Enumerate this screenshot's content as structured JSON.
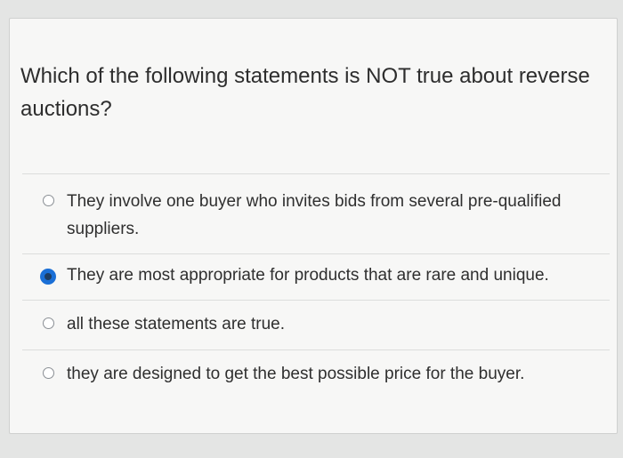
{
  "question": {
    "text": "Which of the following statements is NOT true about reverse auctions?"
  },
  "answers": [
    {
      "text": "They involve one buyer who invites bids from several pre-qualified suppliers.",
      "selected": false
    },
    {
      "text": "They are most appropriate for products that are rare and unique.",
      "selected": true
    },
    {
      "text": "all these statements are true.",
      "selected": false
    },
    {
      "text": "they are designed to get the best possible price for the buyer.",
      "selected": false
    }
  ],
  "colors": {
    "selected_radio": "#1a6fd6",
    "background": "#e4e5e4",
    "card": "#f7f7f6"
  }
}
